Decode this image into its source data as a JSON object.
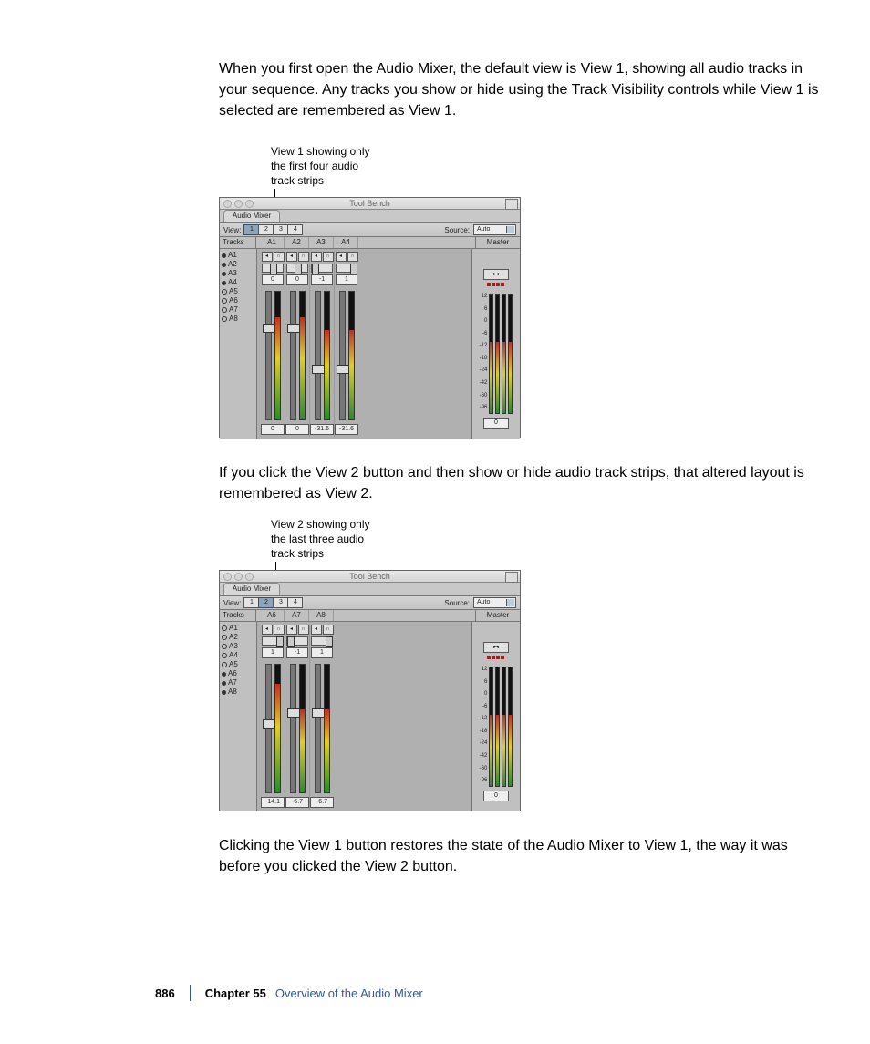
{
  "paragraphs": {
    "p1": "When you first open the Audio Mixer, the default view is View 1, showing all audio tracks in your sequence. Any tracks you show or hide using the Track Visibility controls while View 1 is selected are remembered as View 1.",
    "p2": "If you click the View 2 button and then show or hide audio track strips, that altered layout is remembered as View 2.",
    "p3": "Clicking the View 1 button restores the state of the Audio Mixer to View 1, the way it was before you clicked the View 2 button."
  },
  "callouts": {
    "c1_l1": "View 1 showing only",
    "c1_l2": "the first four audio",
    "c1_l3": "track strips",
    "c2_l1": "View 2 showing only",
    "c2_l2": "the last three audio",
    "c2_l3": "track strips"
  },
  "mixer": {
    "title": "Tool Bench",
    "tab": "Audio Mixer",
    "view_label": "View:",
    "source_label": "Source:",
    "source_value": "Auto",
    "tracks_header": "Tracks",
    "master_header": "Master",
    "view_buttons": {
      "b1": "1",
      "b2": "2",
      "b3": "3",
      "b4": "4"
    },
    "master_readout": "0",
    "master_scale": {
      "s0": "12",
      "s1": "6",
      "s2": "0",
      "s3": "-6",
      "s4": "-12",
      "s5": "-18",
      "s6": "-24",
      "s7": "-42",
      "s8": "-60",
      "s9": "-96"
    },
    "mbtn": "▸◂"
  },
  "fig1": {
    "tracks": {
      "t1": "A1",
      "t2": "A2",
      "t3": "A3",
      "t4": "A4",
      "t5": "A5",
      "t6": "A6",
      "t7": "A7",
      "t8": "A8"
    },
    "strip_headers": {
      "h1": "A1",
      "h2": "A2",
      "h3": "A3",
      "h4": "A4"
    },
    "pan_vals": {
      "v1": "0",
      "v2": "0",
      "v3": "-1",
      "v4": "1"
    },
    "readouts": {
      "r1": "0",
      "r2": "0",
      "r3": "-31.6",
      "r4": "-31.6"
    }
  },
  "fig2": {
    "tracks": {
      "t1": "A1",
      "t2": "A2",
      "t3": "A3",
      "t4": "A4",
      "t5": "A5",
      "t6": "A6",
      "t7": "A7",
      "t8": "A8"
    },
    "strip_headers": {
      "h1": "A6",
      "h2": "A7",
      "h3": "A8"
    },
    "pan_vals": {
      "v1": "1",
      "v2": "-1",
      "v3": "1"
    },
    "readouts": {
      "r1": "-14.1",
      "r2": "-6.7",
      "r3": "-6.7"
    }
  },
  "footer": {
    "page": "886",
    "chapter_label": "Chapter 55",
    "chapter_title": "Overview of the Audio Mixer"
  }
}
